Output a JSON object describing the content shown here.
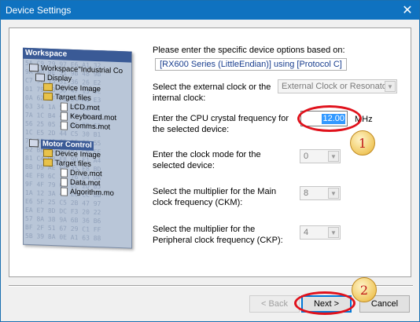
{
  "window": {
    "title": "Device Settings",
    "close_glyph": "✕"
  },
  "illustration": {
    "header": "Workspace",
    "hex_text": "AD 2F 16 DE 7F 2A 3E\n5A C9 79 97 E6 A1 32\n9A 4D 0E 31 9B 48 9B\nC7 9C 15 31 36 26 E2\n01 79 43 5D 47 15 9C\n0A 62 BF F5 34 A6 E3\n63 34 1A 53 75 8E A1\n7A 1C B4 4A 7C 3E 50\n56 25 05 2F A6 5D 61\n1C E5 2D 44 C5 30 B1\n71 BB 40 6B 25 06 55\n52 BB 32 4D B7 C6 EE\n81 C4 D8 F8 9D F1 A4\nBB D9 AE 60 35 E8 BD\n4E FB 6C 13 76 D4 DA\n9F 4F 79 6C EC 2D B5\n1A 12 3A 46 E6 CC 8B\nE6 5F 25 C5 2B 47 97\nEA E7 8D DC F3 20 22\n57 8A 38 9A 6B 36 B6\nBF 2F 51 67 29 C1 FF\n5B 39 8A 0E A1 63 88",
    "tree": {
      "workspace": "Workspace\"Industrial Co",
      "display": "Display",
      "device_image": "Device Image",
      "target_files": "Target files",
      "file1": "LCD.mot",
      "file2": "Keyboard.mot",
      "file3": "Comms.mot",
      "motor_control": "Motor Control",
      "device_image2": "Device Image",
      "target_files2": "Target files",
      "file4": "Drive.mot",
      "file5": "Data.mot",
      "file6": "Algorithm.mo"
    }
  },
  "form": {
    "intro": "Please enter the specific device options based on:",
    "target": "[RX600 Series (LittleEndian)]  using  [Protocol C]",
    "clock_source_label": "Select the external clock or the internal clock:",
    "clock_source_value": "External Clock or Resonator",
    "freq_label": "Enter the CPU crystal frequency for the selected device:",
    "freq_value": "12.00",
    "freq_unit": "MHz",
    "clock_mode_label": "Enter the clock mode for the selected device:",
    "clock_mode_value": "0",
    "main_mult_label": "Select the multiplier for the Main clock frequency (CKM):",
    "main_mult_value": "8",
    "periph_mult_label": "Select the multiplier for the Peripheral clock frequency (CKP):",
    "periph_mult_value": "4"
  },
  "annotations": {
    "badge1": "1",
    "badge2": "2",
    "ring_color": "#e0121c"
  },
  "buttons": {
    "back": "< Back",
    "next": "Next >",
    "cancel": "Cancel"
  },
  "colors": {
    "titlebar": "#0f72c0",
    "accent": "#0078d7",
    "selection": "#3399ff"
  }
}
